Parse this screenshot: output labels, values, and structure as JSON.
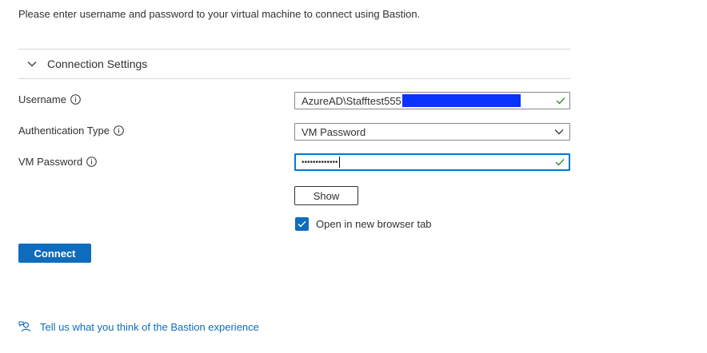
{
  "intro_text": "Please enter username and password to your virtual machine to connect using Bastion.",
  "section": {
    "title": "Connection Settings",
    "icon": "chevron-down-icon"
  },
  "fields": {
    "username": {
      "label": "Username",
      "value": "AzureAD\\Stafftest555",
      "valid": true
    },
    "auth_type": {
      "label": "Authentication Type",
      "selected": "VM Password"
    },
    "vm_password": {
      "label": "VM Password",
      "masked_value": "•••••••••••••",
      "valid": true
    }
  },
  "show_button": "Show",
  "open_in_new_tab": {
    "label": "Open in new browser tab",
    "checked": true
  },
  "connect_button": "Connect",
  "feedback_link": "Tell us what you think of the Bastion experience",
  "colors": {
    "accent": "#0f6cbd",
    "focus": "#0078d4",
    "success": "#107c10",
    "redaction": "#0a33ff"
  }
}
